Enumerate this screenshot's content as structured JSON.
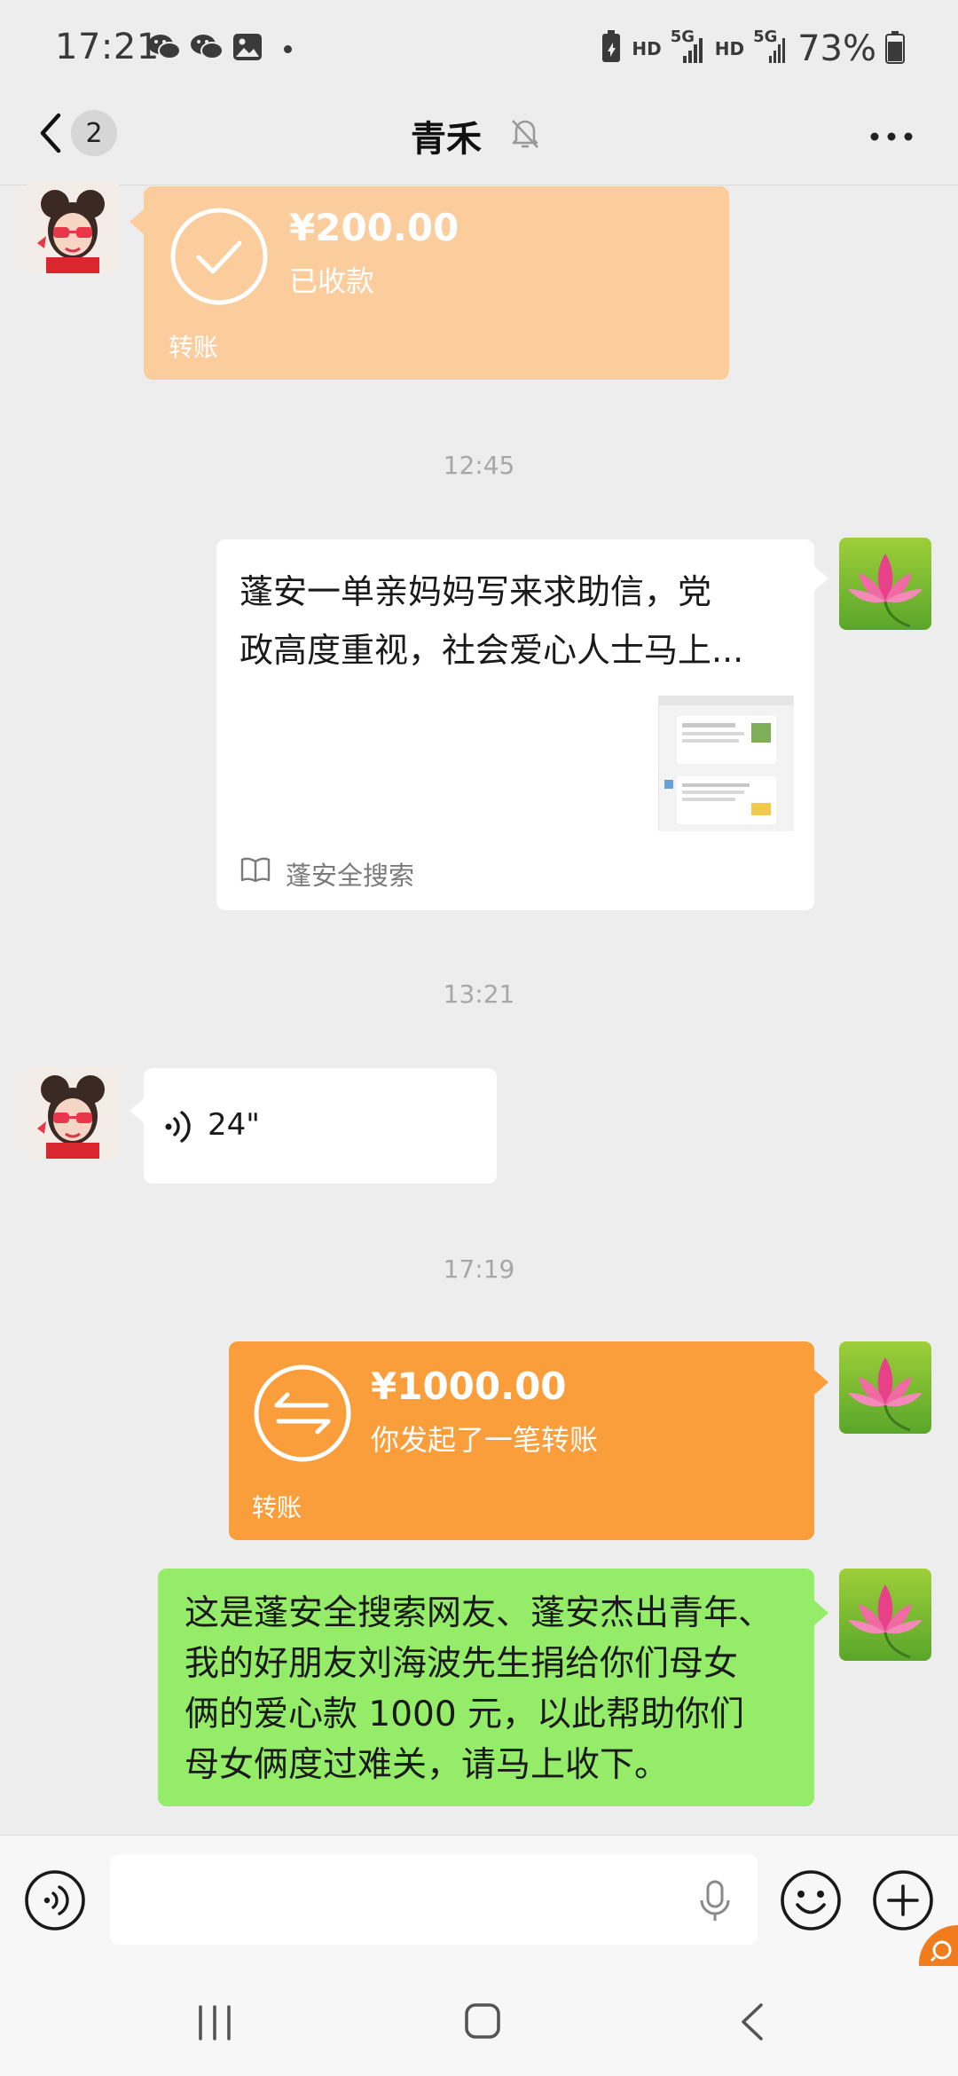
{
  "status_bar": {
    "time": "17:21",
    "left_icons": [
      "wechat-icon",
      "wechat-icon",
      "gallery-icon",
      "notification-dot"
    ],
    "hd_label_1": "HD",
    "net_label_1": "5G",
    "hd_label_2": "HD",
    "net_label_2": "5G",
    "battery": "73%"
  },
  "header": {
    "unread_count": "2",
    "title": "青禾",
    "muted": true
  },
  "messages": [
    {
      "type": "transfer",
      "side": "left",
      "amount": "¥200.00",
      "status": "已收款",
      "footer": "转账",
      "color": "#fbcd9d"
    },
    {
      "type": "timestamp",
      "text": "12:45"
    },
    {
      "type": "link",
      "side": "right",
      "title_line1": "蓬安一单亲妈妈写来求助信，党",
      "title_line2": "政高度重视，社会爱心人士马上...",
      "source": "蓬安全搜索"
    },
    {
      "type": "timestamp",
      "text": "13:21"
    },
    {
      "type": "voice",
      "side": "left",
      "duration": "24\""
    },
    {
      "type": "timestamp",
      "text": "17:19"
    },
    {
      "type": "transfer",
      "side": "right",
      "amount": "¥1000.00",
      "status": "你发起了一笔转账",
      "footer": "转账",
      "color": "#fa9d3b"
    },
    {
      "type": "text",
      "side": "right",
      "lines": [
        "这是蓬安全搜索网友、蓬安杰出青年、",
        "我的好朋友刘海波先生捐给你们母女",
        "俩的爱心款 1000 元，以此帮助你们",
        "母女俩度过难关，请马上收下。"
      ],
      "color": "#95ec69"
    }
  ],
  "input_bar": {
    "left_icon": "voice-mode-icon",
    "mic_icon": "microphone-icon",
    "emoji_icon": "emoji-icon",
    "plus_icon": "plus-icon"
  },
  "nav_bar": {
    "icons": [
      "recent-apps-icon",
      "home-icon",
      "back-icon"
    ]
  }
}
